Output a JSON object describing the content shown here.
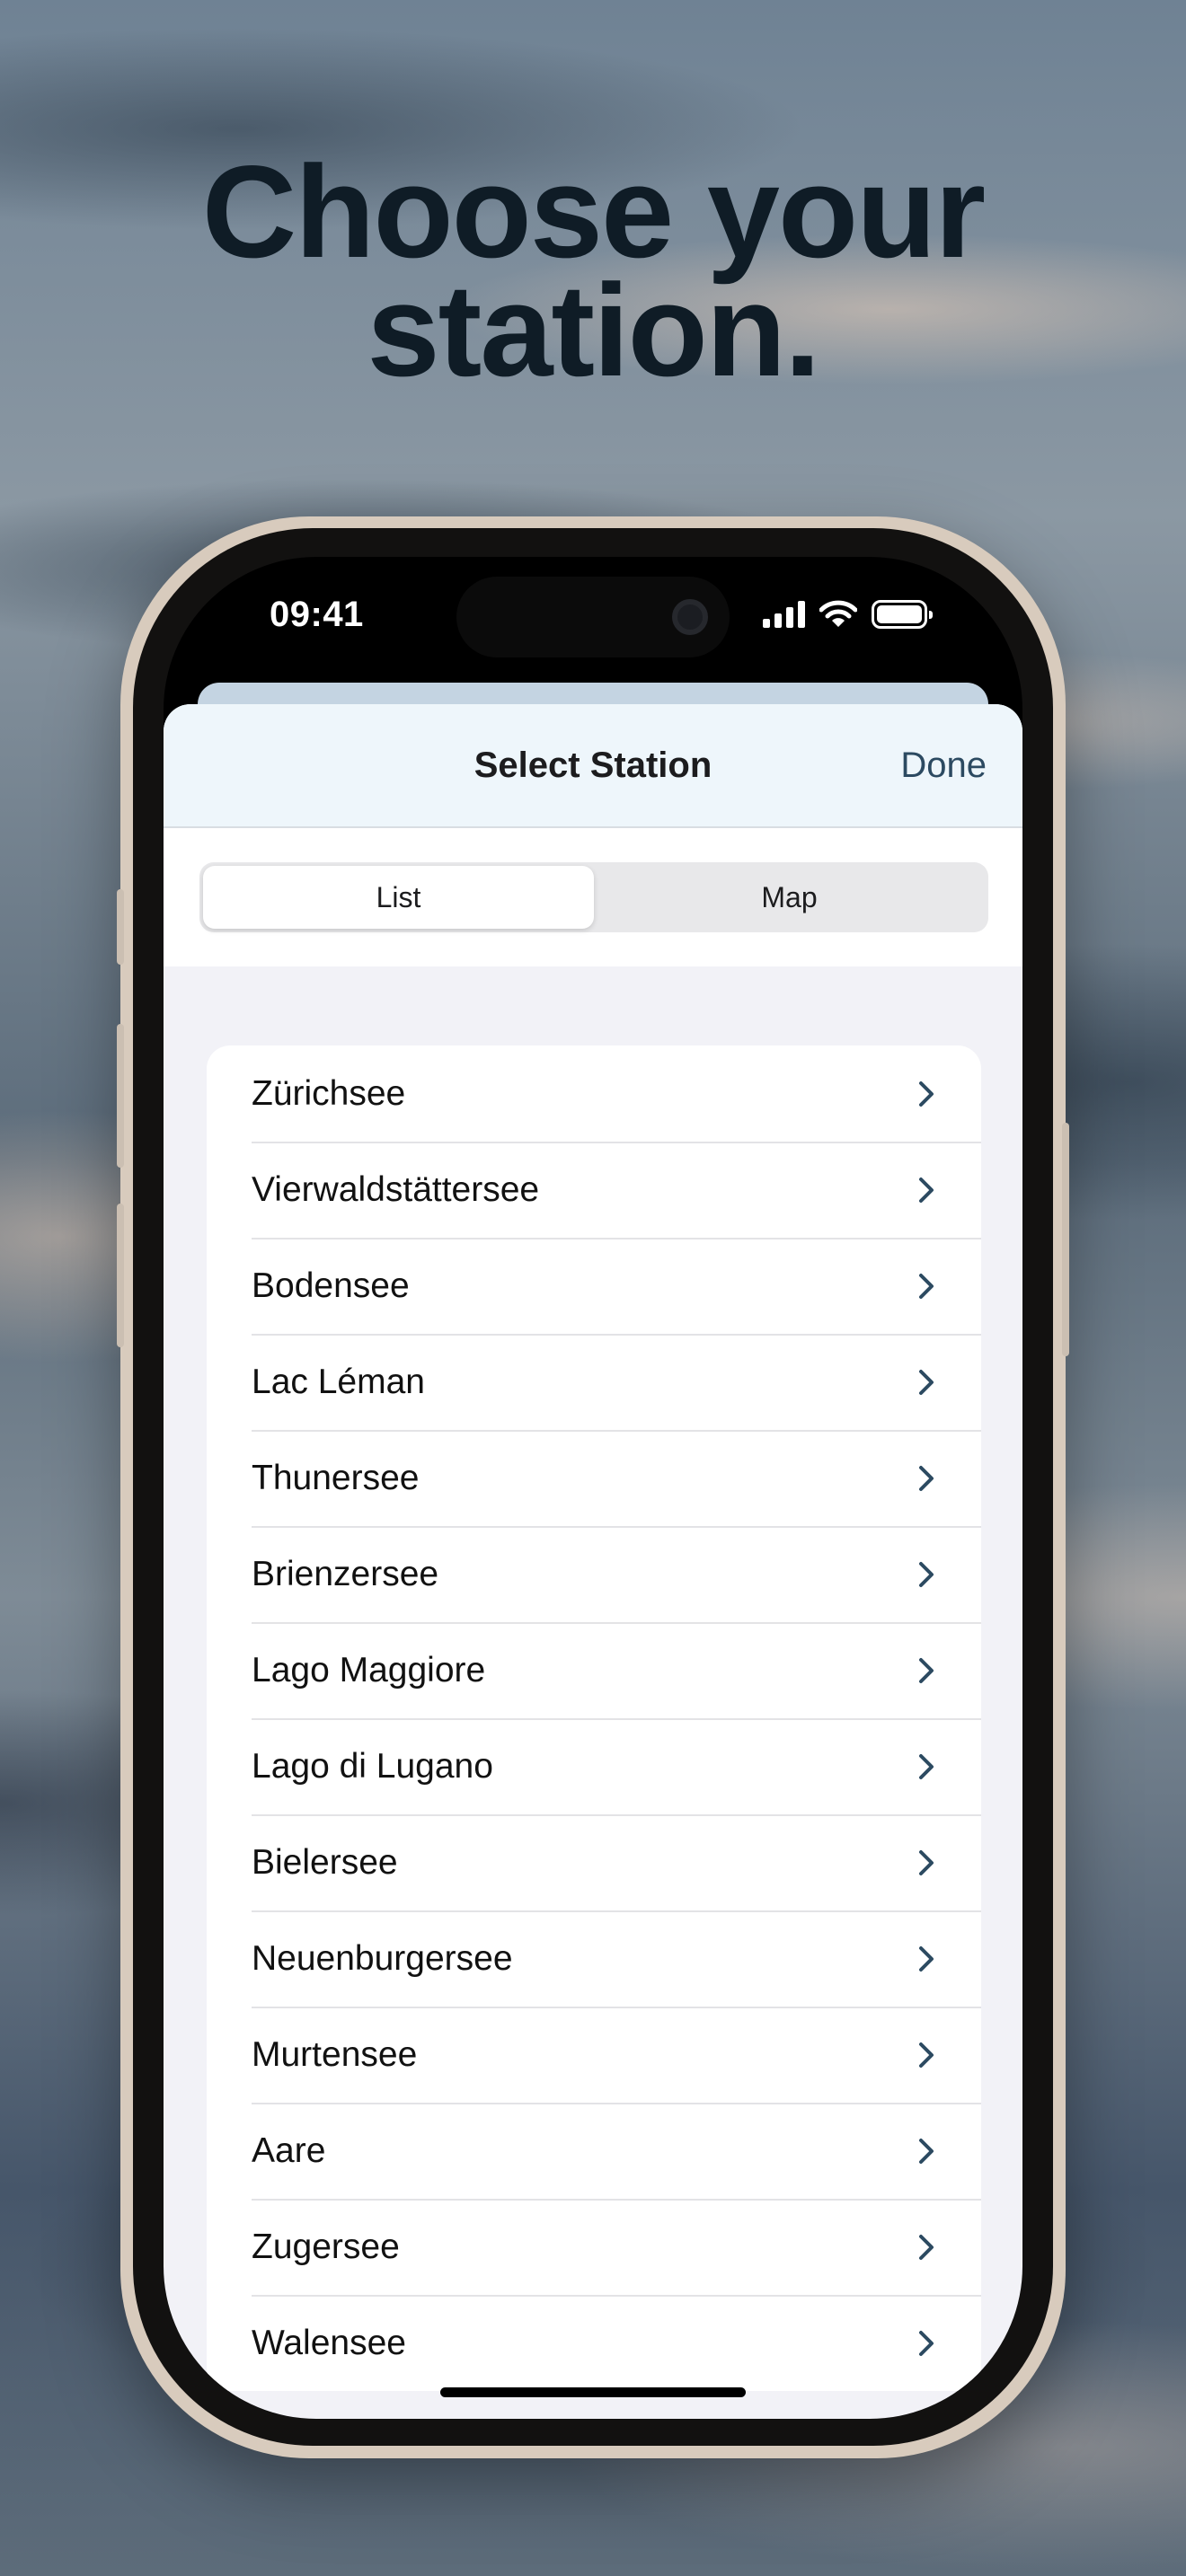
{
  "headline": {
    "line1": "Choose your",
    "line2": "station."
  },
  "status_bar": {
    "time": "09:41"
  },
  "sheet": {
    "title": "Select Station",
    "done_label": "Done",
    "segments": [
      {
        "label": "List",
        "selected": true
      },
      {
        "label": "Map",
        "selected": false
      }
    ],
    "stations": [
      {
        "label": "Zürichsee"
      },
      {
        "label": "Vierwaldstättersee"
      },
      {
        "label": "Bodensee"
      },
      {
        "label": "Lac Léman"
      },
      {
        "label": "Thunersee"
      },
      {
        "label": "Brienzersee"
      },
      {
        "label": "Lago Maggiore"
      },
      {
        "label": "Lago di Lugano"
      },
      {
        "label": "Bielersee"
      },
      {
        "label": "Neuenburgersee"
      },
      {
        "label": "Murtensee"
      },
      {
        "label": "Aare"
      },
      {
        "label": "Zugersee"
      },
      {
        "label": "Walensee"
      }
    ]
  },
  "icons": {
    "row_chevron": "chevron-right-icon",
    "cellular": "cellular-signal-icon",
    "wifi": "wifi-icon",
    "battery": "battery-icon"
  },
  "colors": {
    "headline": "#0f1c26",
    "nav_bar_bg": "#eef6fb",
    "done_accent": "#2c4a61",
    "chevron": "#2c4a61"
  }
}
